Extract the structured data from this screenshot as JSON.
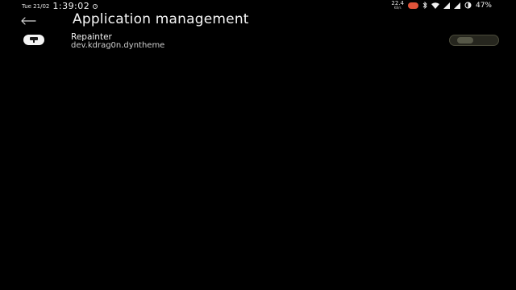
{
  "status_bar": {
    "date": "Tue 21/02",
    "time": "1:39:02",
    "net_speed": "22.4",
    "net_unit": "KB/s",
    "notif_badge": "",
    "battery_percent": "47%"
  },
  "header": {
    "title": "Application management"
  },
  "apps": [
    {
      "name": "Repainter",
      "package": "dev.kdrag0n.dyntheme",
      "enabled": false
    }
  ],
  "colors": {
    "background": "#000000",
    "text": "#f5f5f5",
    "toggle_track": "#26261e",
    "toggle_knob": "#565747",
    "badge": "#e0533a"
  },
  "icons": {
    "back": "arrow-left-icon",
    "record": "screen-record-icon",
    "bluetooth": "bluetooth-icon",
    "wifi": "wifi-icon",
    "signal": "signal-icon",
    "battery": "battery-icon",
    "app": "repainter-app-icon"
  }
}
